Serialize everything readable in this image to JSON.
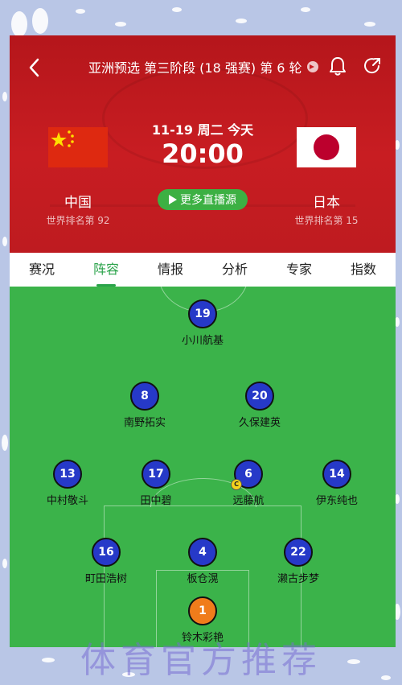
{
  "header": {
    "title": "亚洲预选 第三阶段 (18 强赛) 第 6 轮",
    "date": "11-19 周二 今天",
    "time": "20:00",
    "live_button": "更多直播源",
    "home": {
      "name": "中国",
      "rank": "世界排名第 92",
      "flag": "china-flag-icon"
    },
    "away": {
      "name": "日本",
      "rank": "世界排名第 15",
      "flag": "japan-flag-icon"
    }
  },
  "tabs": [
    {
      "label": "赛况"
    },
    {
      "label": "阵容",
      "active": true
    },
    {
      "label": "情报"
    },
    {
      "label": "分析"
    },
    {
      "label": "专家"
    },
    {
      "label": "指数"
    }
  ],
  "lineup": [
    {
      "num": "19",
      "name": "小川航基"
    },
    {
      "num": "8",
      "name": "南野拓实"
    },
    {
      "num": "20",
      "name": "久保建英"
    },
    {
      "num": "13",
      "name": "中村敬斗"
    },
    {
      "num": "17",
      "name": "田中碧"
    },
    {
      "num": "6",
      "name": "远藤航",
      "captain": "C"
    },
    {
      "num": "14",
      "name": "伊东纯也"
    },
    {
      "num": "16",
      "name": "町田浩树"
    },
    {
      "num": "4",
      "name": "板仓滉"
    },
    {
      "num": "22",
      "name": "濑古步梦"
    },
    {
      "num": "1",
      "name": "铃木彩艳",
      "goalkeeper": true
    }
  ],
  "colors": {
    "header_red": "#c81d22",
    "accent_green": "#2aa34a",
    "player_blue": "#2639c8",
    "gk_orange": "#f07c1b"
  },
  "watermark": "体育官方推荐"
}
